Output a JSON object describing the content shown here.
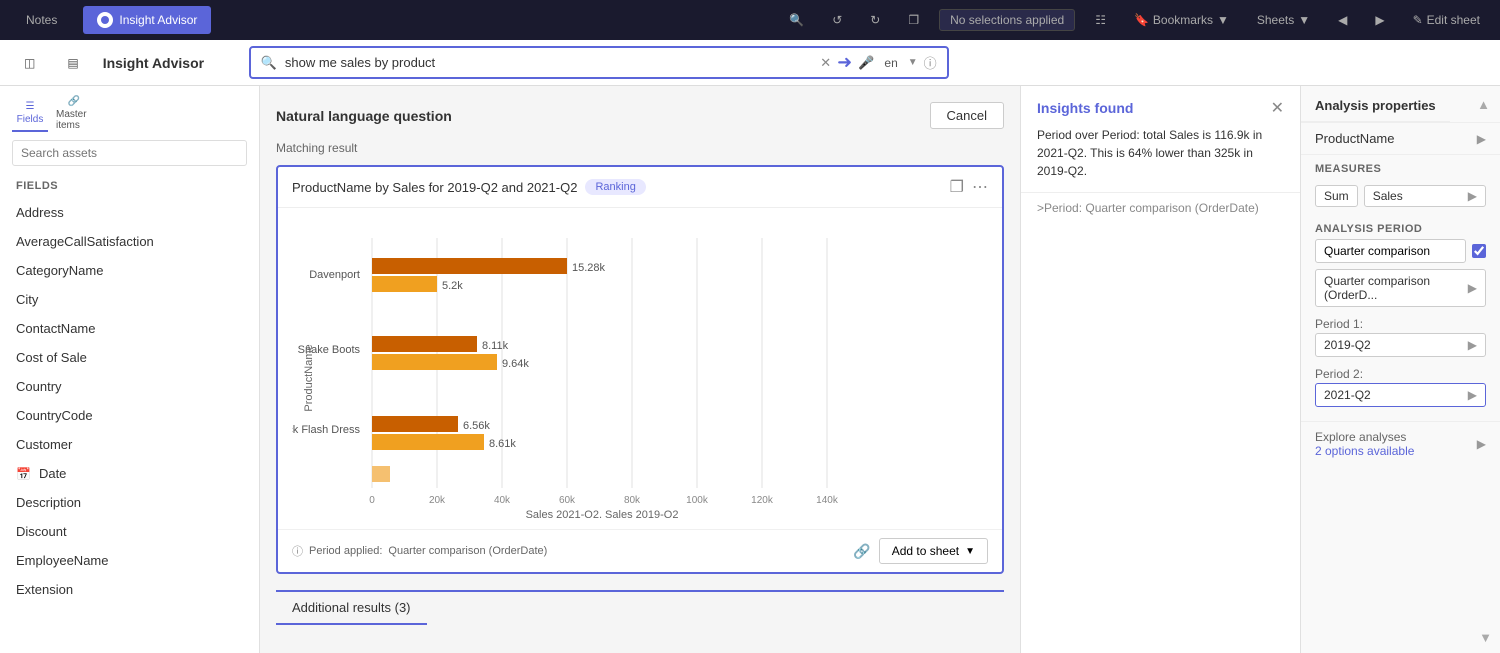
{
  "topNav": {
    "notes_label": "Notes",
    "insight_advisor_label": "Insight Advisor",
    "no_selections": "No selections applied",
    "bookmarks_label": "Bookmarks",
    "sheets_label": "Sheets",
    "edit_sheet_label": "Edit sheet"
  },
  "secondBar": {
    "title": "Insight Advisor",
    "search_value": "show me sales by product",
    "lang": "en"
  },
  "sidebar": {
    "search_placeholder": "Search assets",
    "fields_label": "Fields",
    "master_items_label": "Master items",
    "section_title": "Fields",
    "items": [
      {
        "label": "Address",
        "icon": null
      },
      {
        "label": "AverageCallSatisfaction",
        "icon": null
      },
      {
        "label": "CategoryName",
        "icon": null
      },
      {
        "label": "City",
        "icon": null
      },
      {
        "label": "ContactName",
        "icon": null
      },
      {
        "label": "Cost of Sale",
        "icon": null
      },
      {
        "label": "Country",
        "icon": null
      },
      {
        "label": "CountryCode",
        "icon": null
      },
      {
        "label": "Customer",
        "icon": null
      },
      {
        "label": "Date",
        "icon": "calendar"
      },
      {
        "label": "Description",
        "icon": null
      },
      {
        "label": "Discount",
        "icon": null
      },
      {
        "label": "EmployeeName",
        "icon": null
      },
      {
        "label": "Extension",
        "icon": null
      }
    ]
  },
  "mainPanel": {
    "nlq_title": "Natural language question",
    "cancel_label": "Cancel",
    "matching_result_label": "Matching result",
    "chart": {
      "title": "ProductName by Sales for 2019-Q2 and 2021-Q2",
      "badge": "Ranking",
      "x_label": "Sales 2021-Q2, Sales 2019-Q2",
      "period_label": "Period applied:",
      "period_value": "Quarter comparison (OrderDate)",
      "add_to_sheet_label": "Add to sheet",
      "bars": [
        {
          "product": "Davenport",
          "val1": 15.28,
          "label1": "15.28k",
          "val2": 5.2,
          "label2": "5.2k"
        },
        {
          "product": "Snake Boots",
          "val1": 8.11,
          "label1": "8.11k",
          "val2": 9.64,
          "label2": "9.64k"
        },
        {
          "product": "Jumpin Jack Flash Dress",
          "val1": 6.56,
          "label1": "6.56k",
          "val2": 8.61,
          "label2": "8.61k"
        },
        {
          "product": "",
          "val1": 0,
          "label1": "",
          "val2": 0,
          "label2": ""
        }
      ],
      "x_ticks": [
        "0",
        "20k",
        "40k",
        "60k",
        "80k",
        "100k",
        "120k",
        "140k"
      ]
    },
    "additional_results_label": "Additional results (3)"
  },
  "insightsPanel": {
    "title": "Insights found",
    "content": "Period over Period: total Sales is 116.9k in 2021-Q2. This is 64% lower than 325k in 2019-Q2.",
    "period_detail": ">Period: Quarter comparison (OrderDate)"
  },
  "rightPanel": {
    "title": "Analysis properties",
    "field_label": "ProductName",
    "measures_title": "Measures",
    "sum_label": "Sum",
    "sales_label": "Sales",
    "analysis_period_title": "Analysis period",
    "quarter_comparison_label": "Quarter comparison",
    "quarter_comparison_detail": "Quarter comparison (OrderD...",
    "period1_label": "Period 1:",
    "period1_value": "2019-Q2",
    "period2_label": "Period 2:",
    "period2_value": "2021-Q2",
    "explore_title": "Explore analyses",
    "explore_link": "2 options available"
  }
}
